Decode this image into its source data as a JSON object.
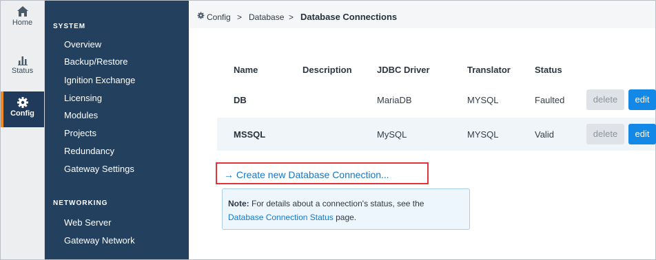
{
  "rail": {
    "items": [
      {
        "label": "Home",
        "icon": "home-icon"
      },
      {
        "label": "Status",
        "icon": "bar-chart-icon"
      },
      {
        "label": "Config",
        "icon": "gear-icon",
        "active": true
      }
    ]
  },
  "sidebar": {
    "sections": [
      {
        "title": "SYSTEM",
        "items": [
          "Overview",
          "Backup/Restore",
          "Ignition Exchange",
          "Licensing",
          "Modules",
          "Projects",
          "Redundancy",
          "Gateway Settings"
        ]
      },
      {
        "title": "NETWORKING",
        "items": [
          "Web Server",
          "Gateway Network"
        ]
      }
    ]
  },
  "breadcrumb": {
    "items": [
      "Config",
      "Database",
      "Database Connections"
    ],
    "separator": ">"
  },
  "table": {
    "columns": [
      "Name",
      "Description",
      "JDBC Driver",
      "Translator",
      "Status"
    ],
    "rows": [
      {
        "name": "DB",
        "description": "",
        "driver": "MariaDB",
        "translator": "MYSQL",
        "status": "Faulted",
        "delete": "delete",
        "edit": "edit"
      },
      {
        "name": "MSSQL",
        "description": "",
        "driver": "MySQL",
        "translator": "MYSQL",
        "status": "Valid",
        "delete": "delete",
        "edit": "edit"
      }
    ]
  },
  "create_link": {
    "arrow": "→",
    "label": "Create new Database Connection..."
  },
  "note": {
    "prefix": "Note:",
    "text1": " For details about a connection's status, see the",
    "link": "Database Connection Status",
    "text2": " page."
  },
  "colors": {
    "sidebar_bg": "#23405e",
    "accent": "#f28b20",
    "edit_button": "#1488e6",
    "link": "#1477c9",
    "highlight_box": "#e0333a"
  }
}
